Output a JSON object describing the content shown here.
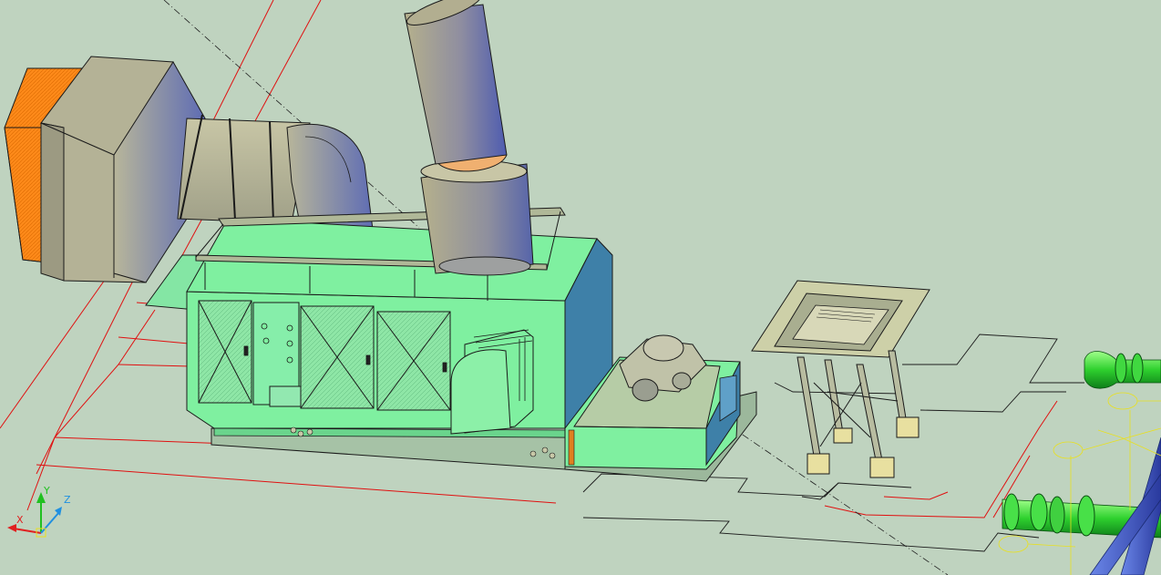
{
  "viewport": {
    "background": "#bfd3bf",
    "ucs_icon": {
      "x_label": "X",
      "y_label": "Y",
      "z_label": "Z",
      "x_color": "#e02020",
      "y_color": "#20c020",
      "z_color": "#2090e0"
    }
  },
  "colors": {
    "grid_red": "#e01010",
    "outline_black": "#101010",
    "enclosure_green": "#7ff0a0",
    "enclosure_blue": "#3e80a8",
    "duct_gray": "#b0b090",
    "filter_orange": "#ff8a1a",
    "stack_blue": "#5a66a8",
    "stack_gray": "#a8a488",
    "pipe_green": "#38d838",
    "pipe_blue": "#4060c8",
    "tag_yellow": "#e8e020"
  }
}
